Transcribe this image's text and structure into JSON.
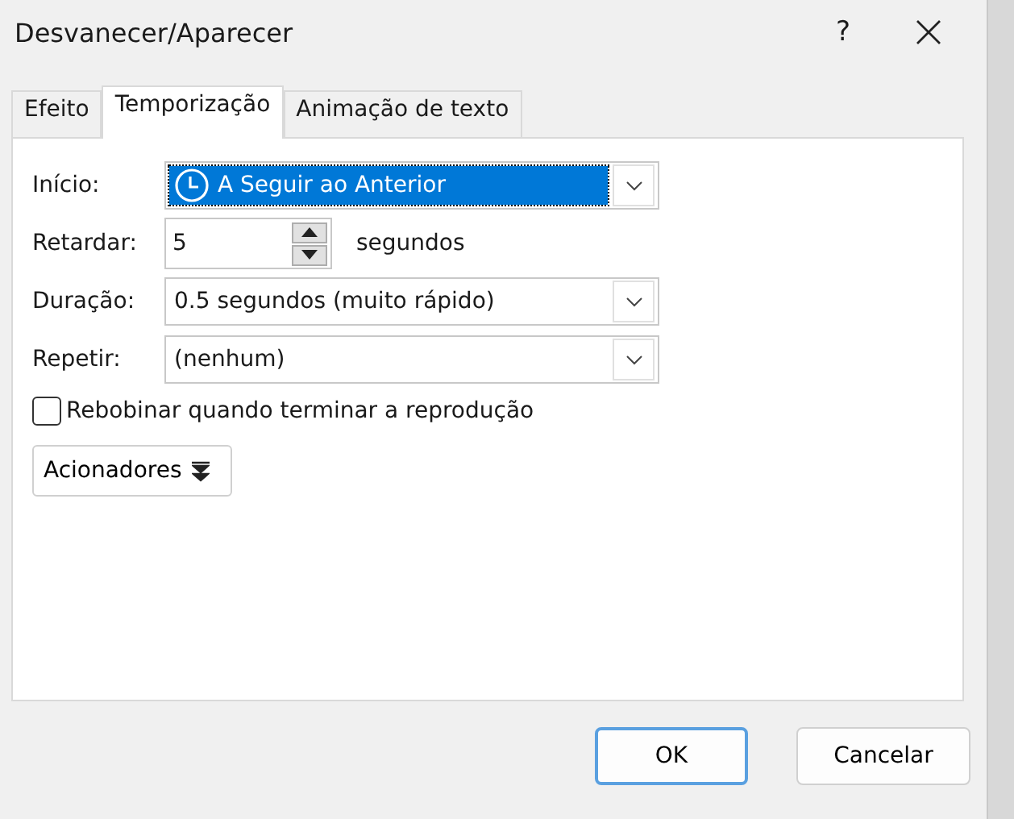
{
  "window": {
    "title": "Desvanecer/Aparecer",
    "help": "?"
  },
  "tabs": [
    {
      "label": "Efeito",
      "selected": false
    },
    {
      "label": "Temporização",
      "selected": true
    },
    {
      "label": "Animação de texto",
      "selected": false
    }
  ],
  "fields": [
    {
      "kind": "clock-combo",
      "label": "Início:",
      "value": "A Seguir ao Anterior",
      "focused": true
    },
    {
      "kind": "spin",
      "label": "Retardar:",
      "value": "5",
      "unit": "segundos",
      "focused": false
    },
    {
      "kind": "combo",
      "label": "Duração:",
      "value": "0.5 segundos (muito rápido)",
      "focused": false
    },
    {
      "kind": "combo",
      "label": "Repetir:",
      "value": "(nenhum)",
      "focused": false
    }
  ],
  "rewind": {
    "label": "Rebobinar quando terminar a reprodução",
    "checked": false
  },
  "triggers": {
    "label": "Acionadores"
  },
  "buttons": [
    {
      "label": "OK",
      "default": true
    },
    {
      "label": "Cancelar",
      "default": false
    }
  ]
}
